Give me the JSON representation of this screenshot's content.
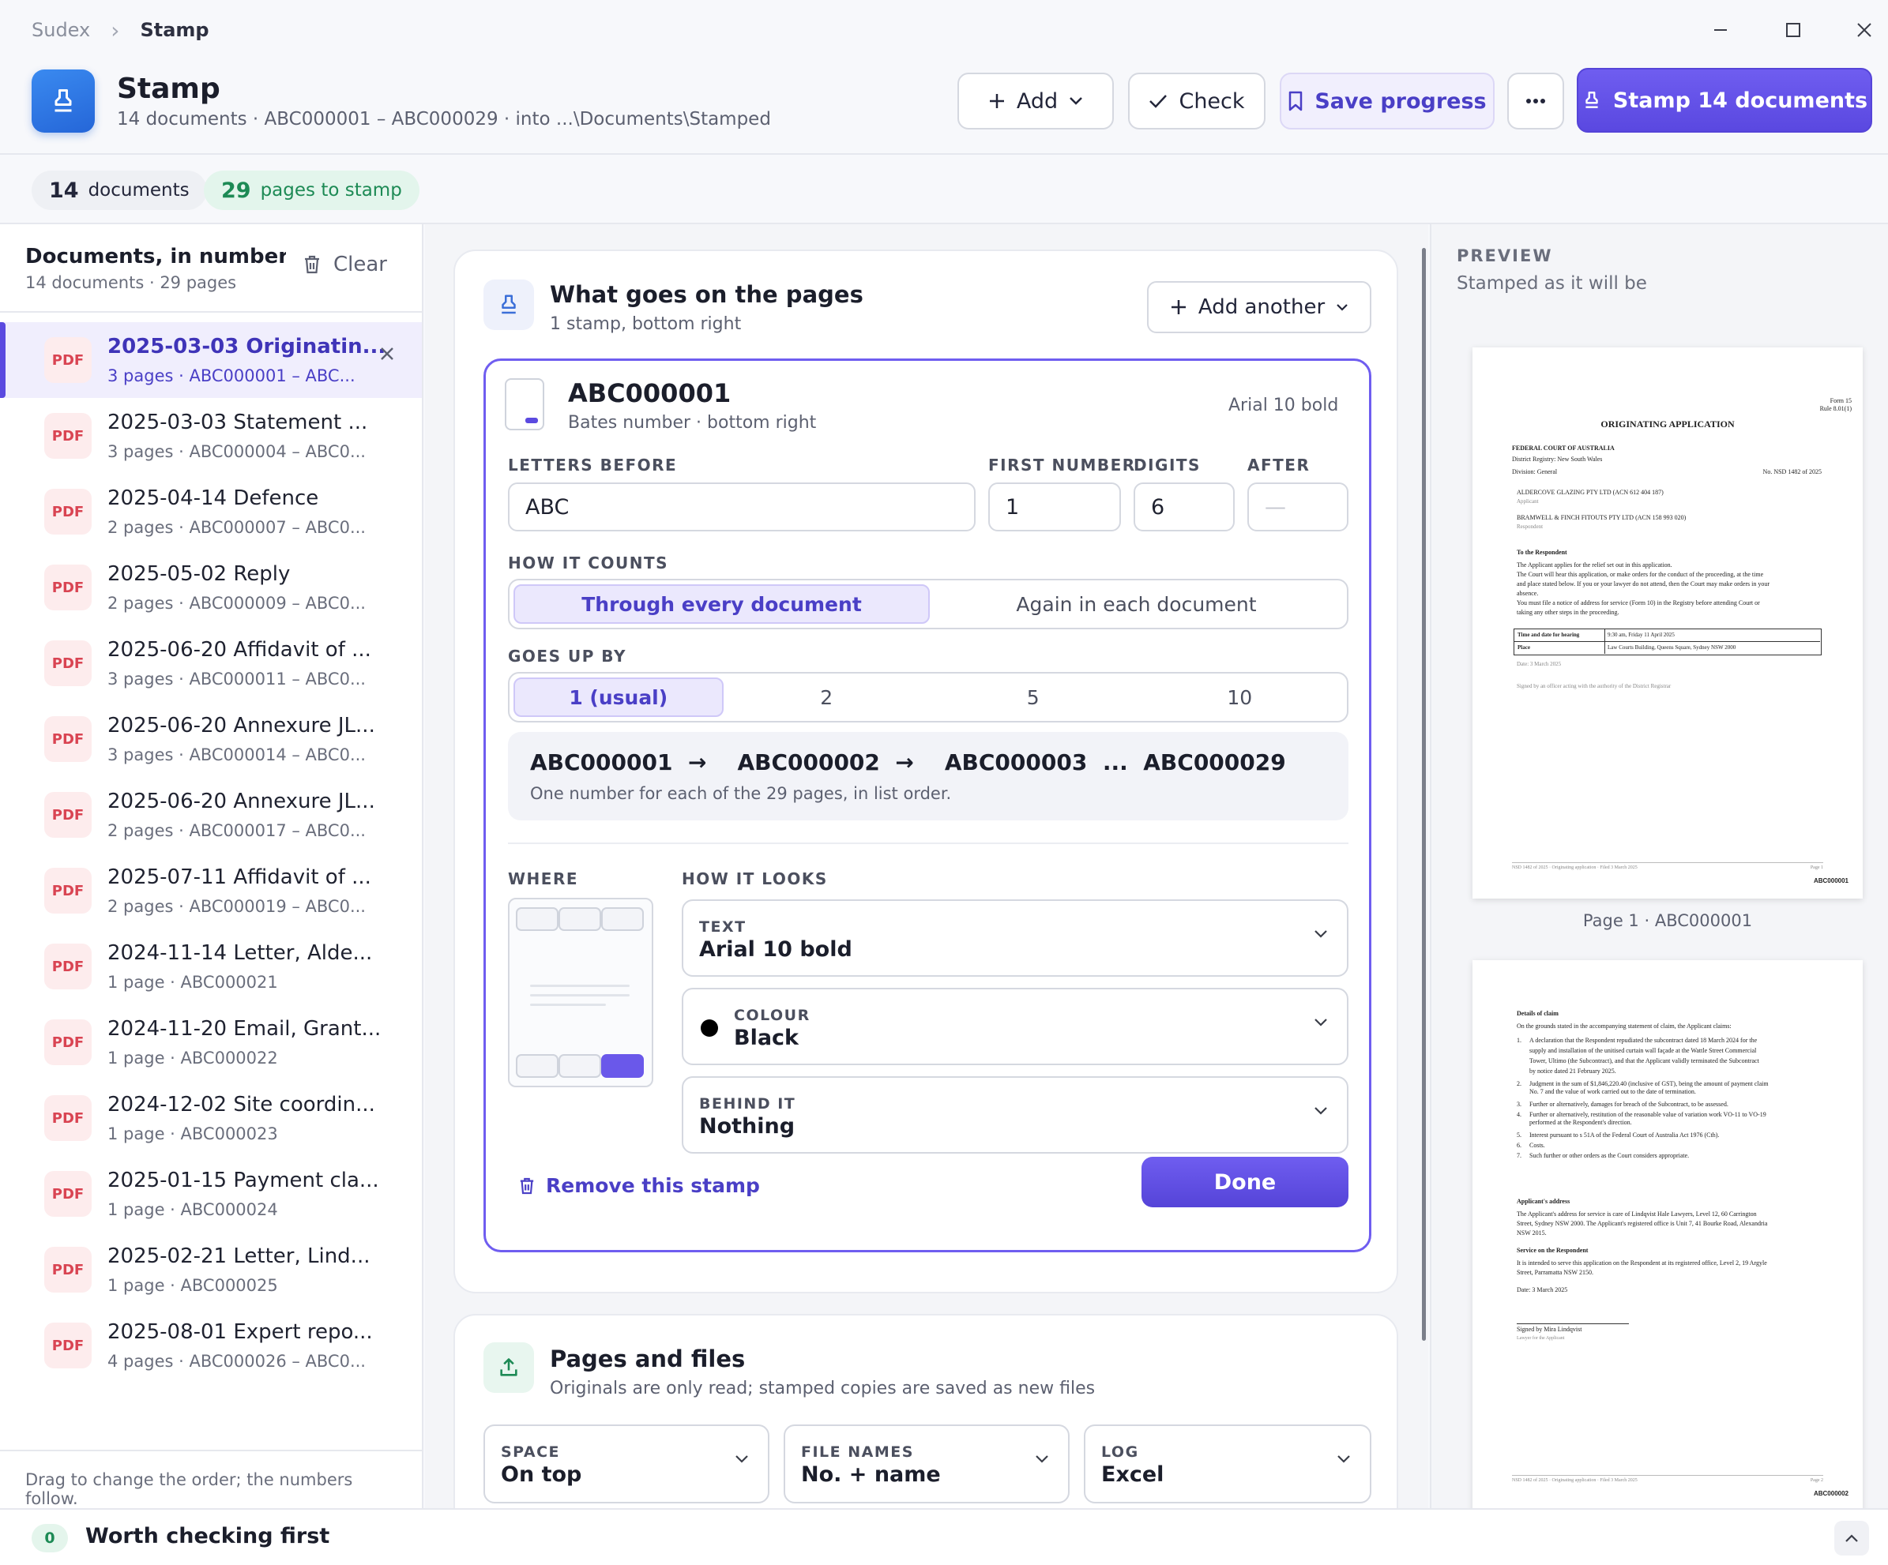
{
  "titlebar": {
    "breadcrumb_root": "Sudex",
    "breadcrumb_current": "Stamp"
  },
  "header": {
    "title": "Stamp",
    "subtitle": "14 documents · ABC000001 – ABC000029 · into ...\\Documents\\Stamped",
    "add_label": "Add",
    "check_label": "Check",
    "save_label": "Save progress",
    "stamp_label": "Stamp 14 documents"
  },
  "stats": {
    "documents_count": "14",
    "documents_label": "documents",
    "pages_count": "29",
    "pages_label": "pages to stamp"
  },
  "sidebar": {
    "title": "Documents, in number or",
    "subtitle": "14 documents · 29 pages",
    "clear_label": "Clear",
    "footer": "Drag to change the order; the numbers follow.",
    "items": [
      {
        "badge": "PDF",
        "name": "2025-03-03 Originatin...",
        "meta": "3 pages · ABC000001 – ABC...",
        "selected": true
      },
      {
        "badge": "PDF",
        "name": "2025-03-03 Statement ...",
        "meta": "3 pages · ABC000004 – ABC0..."
      },
      {
        "badge": "PDF",
        "name": "2025-04-14 Defence",
        "meta": "2 pages · ABC000007 – ABC0..."
      },
      {
        "badge": "PDF",
        "name": "2025-05-02 Reply",
        "meta": "2 pages · ABC000009 – ABC0..."
      },
      {
        "badge": "PDF",
        "name": "2025-06-20 Affidavit of ...",
        "meta": "3 pages · ABC000011 – ABC0..."
      },
      {
        "badge": "PDF",
        "name": "2025-06-20 Annexure JL...",
        "meta": "3 pages · ABC000014 – ABC0..."
      },
      {
        "badge": "PDF",
        "name": "2025-06-20 Annexure JL...",
        "meta": "2 pages · ABC000017 – ABC0..."
      },
      {
        "badge": "PDF",
        "name": "2025-07-11 Affidavit of ...",
        "meta": "2 pages · ABC000019 – ABC0..."
      },
      {
        "badge": "PDF",
        "name": "2024-11-14 Letter, Alde...",
        "meta": "1 page · ABC000021"
      },
      {
        "badge": "PDF",
        "name": "2024-11-20 Email, Grant...",
        "meta": "1 page · ABC000022"
      },
      {
        "badge": "PDF",
        "name": "2024-12-02 Site coordin...",
        "meta": "1 page · ABC000023"
      },
      {
        "badge": "PDF",
        "name": "2025-01-15 Payment cla...",
        "meta": "1 page · ABC000024"
      },
      {
        "badge": "PDF",
        "name": "2025-02-21 Letter, Lind...",
        "meta": "1 page · ABC000025"
      },
      {
        "badge": "PDF",
        "name": "2025-08-01 Expert repo...",
        "meta": "4 pages · ABC000026 – ABC0..."
      }
    ]
  },
  "stamps_card": {
    "title": "What goes on the pages",
    "subtitle": "1 stamp, bottom right",
    "add_another": "Add another",
    "stamp": {
      "name": "ABC000001",
      "kind": "Bates number · bottom right",
      "font_summary": "Arial 10 bold",
      "letters_before_label": "LETTERS BEFORE",
      "letters_before": "ABC",
      "first_number_label": "FIRST NUMBER",
      "first_number": "1",
      "digits_label": "DIGITS",
      "digits": "6",
      "after_label": "AFTER",
      "after_placeholder": "—",
      "counts_label": "HOW IT COUNTS",
      "counts_options": [
        "Through every document",
        "Again in each document"
      ],
      "step_label": "GOES UP BY",
      "step_options": [
        "1 (usual)",
        "2",
        "5",
        "10"
      ],
      "sequence": [
        "ABC000001",
        "→",
        "ABC000002",
        "→",
        "ABC000003",
        "...",
        "ABC000029"
      ],
      "sequence_note": "One number for each of the 29 pages, in list order.",
      "where_label": "WHERE",
      "looks_label": "HOW IT LOOKS",
      "text_label": "TEXT",
      "text_value": "Arial 10 bold",
      "colour_label": "COLOUR",
      "colour_value": "Black",
      "behind_label": "BEHIND IT",
      "behind_value": "Nothing",
      "remove_label": "Remove this stamp",
      "done_label": "Done"
    }
  },
  "files_card": {
    "title": "Pages and files",
    "subtitle": "Originals are only read; stamped copies are saved as new files",
    "space_label": "SPACE",
    "space_value": "On top",
    "names_label": "FILE NAMES",
    "names_value": "No. + name",
    "log_label": "LOG",
    "log_value": "Excel"
  },
  "preview": {
    "label": "PREVIEW",
    "subtitle": "Stamped as it will be",
    "page1_caption": "Page 1 · ABC000001",
    "page1": {
      "form_no": "Form 15",
      "rule": "Rule 8.01(1)",
      "heading": "ORIGINATING APPLICATION",
      "court": "FEDERAL COURT OF AUSTRALIA",
      "registry": "District Registry: New South Wales",
      "division": "Division: General",
      "file_no": "No. NSD 1482 of 2025",
      "applicant": "ALDERCOVE GLAZING PTY LTD (ACN 612 404 187)",
      "applicant_role": "Applicant",
      "respondent": "BRAMWELL & FINCH FITOUTS PTY LTD (ACN 158 993 020)",
      "respondent_role": "Respondent",
      "to_respondent": "To the Respondent",
      "body": [
        "The Applicant applies for the relief set out in this application.",
        "The Court will hear this application, or make orders for the conduct of the proceeding, at the time",
        "and place stated below. If you or your lawyer do not attend, then the Court may make orders in your",
        "absence.",
        "You must file a notice of address for service (Form 10) in the Registry before attending Court or",
        "taking any other steps in the proceeding."
      ],
      "hearing_label": "Time and date for hearing",
      "hearing_value": "9:30 am, Friday 11 April 2025",
      "place_label": "Place",
      "place_value": "Law Courts Building, Queens Square, Sydney NSW 2000",
      "date": "Date: 3 March 2025",
      "signed": "Signed by an officer acting with the authority of the District Registrar",
      "footer_left": "NSD 1482 of 2025 · Originating application · Filed 3 March 2025",
      "footer_right": "Page 1",
      "bates": "ABC000001"
    },
    "page2": {
      "heading": "Details of claim",
      "intro": "On the grounds stated in the accompanying statement of claim, the Applicant claims:",
      "claims": [
        [
          "1.",
          "A declaration that the Respondent repudiated the subcontract dated 18 March 2024 for the"
        ],
        [
          "",
          "supply and installation of the unitised curtain wall façade at the Wattle Street Commercial"
        ],
        [
          "",
          "Tower, Ultimo (the Subcontract), and that the Applicant validly terminated the Subcontract"
        ],
        [
          "",
          "by notice dated 21 February 2025."
        ],
        [
          "2.",
          "Judgment in the sum of $1,846,220.40 (inclusive of GST), being the amount of payment claim"
        ],
        [
          "",
          "No. 7 and the value of work carried out to the date of termination."
        ],
        [
          "3.",
          "Further or alternatively, damages for breach of the Subcontract, to be assessed."
        ],
        [
          "4.",
          "Further or alternatively, restitution of the reasonable value of variation work VO-11 to VO-19"
        ],
        [
          "",
          "performed at the Respondent's direction."
        ],
        [
          "5.",
          "Interest pursuant to s 51A of the Federal Court of Australia Act 1976 (Cth)."
        ],
        [
          "6.",
          "Costs."
        ],
        [
          "7.",
          "Such further or other orders as the Court considers appropriate."
        ]
      ],
      "addr_heading": "Applicant's address",
      "addr_lines": [
        "The Applicant's address for service is care of Lindqvist Hale Lawyers, Level 12, 60 Carrington",
        "Street, Sydney NSW 2000. The Applicant's registered office is Unit 7, 41 Bourke Road, Alexandria",
        "NSW 2015."
      ],
      "service_heading": "Service on the Respondent",
      "service_lines": [
        "It is intended to serve this application on the Respondent at its registered office, Level 2, 19 Argyle",
        "Street, Parramatta NSW 2150."
      ],
      "date": "Date: 3 March 2025",
      "signed": "Signed by Mira Lindqvist",
      "signed_role": "Lawyer for the Applicant",
      "footer_left": "NSD 1482 of 2025 · Originating application · Filed 3 March 2025",
      "footer_right": "Page 2",
      "bates": "ABC000002"
    }
  },
  "bottom": {
    "count": "0",
    "title": "Worth checking first"
  }
}
